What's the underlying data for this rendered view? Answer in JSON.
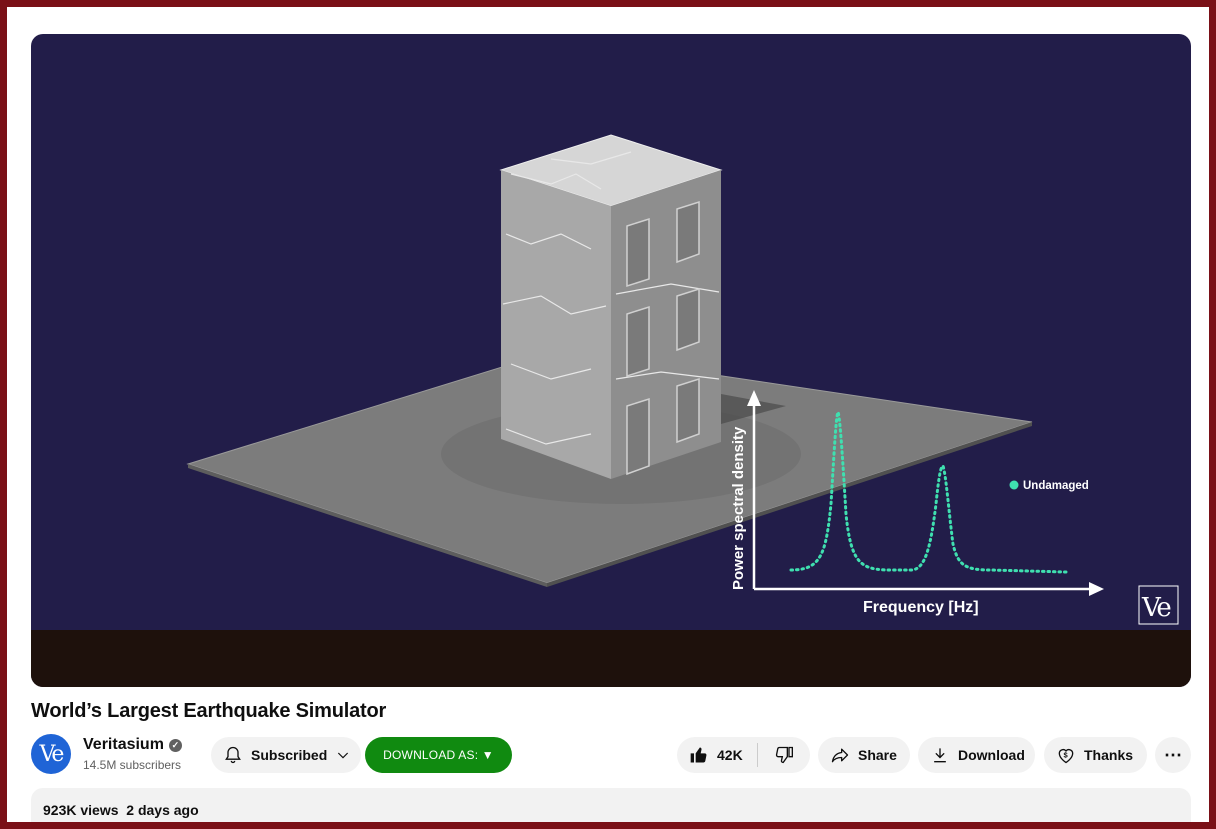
{
  "video": {
    "title": "World’s Largest Earthquake Simulator",
    "overlay": {
      "y_axis_label": "Power spectral density",
      "x_axis_label": "Frequency [Hz]",
      "legend_label": "Undamaged",
      "series_color": "#3fe0b0",
      "watermark": "Ve"
    }
  },
  "channel": {
    "avatar_text": "Ve",
    "name": "Veritasium",
    "verified_mark": "✓",
    "subscribers": "14.5M subscribers"
  },
  "actions": {
    "subscribe_label": "Subscribed",
    "download_as_label": "DOWNLOAD AS: ▼",
    "like_count": "42K",
    "share_label": "Share",
    "download_label": "Download",
    "thanks_label": "Thanks",
    "more_label": "⋯"
  },
  "description": {
    "views": "923K views",
    "date": "2 days ago"
  },
  "colors": {
    "border": "#7a1017",
    "video_bg": "#221d49",
    "download_as_bg": "#108a10"
  }
}
